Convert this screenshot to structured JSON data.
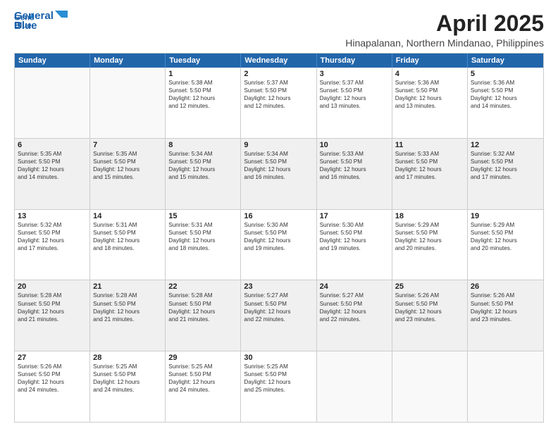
{
  "logo": {
    "line1": "General",
    "line2": "Blue"
  },
  "title": "April 2025",
  "subtitle": "Hinapalanan, Northern Mindanao, Philippines",
  "header_days": [
    "Sunday",
    "Monday",
    "Tuesday",
    "Wednesday",
    "Thursday",
    "Friday",
    "Saturday"
  ],
  "weeks": [
    [
      {
        "day": "",
        "lines": [],
        "empty": true
      },
      {
        "day": "",
        "lines": [],
        "empty": true
      },
      {
        "day": "1",
        "lines": [
          "Sunrise: 5:38 AM",
          "Sunset: 5:50 PM",
          "Daylight: 12 hours",
          "and 12 minutes."
        ]
      },
      {
        "day": "2",
        "lines": [
          "Sunrise: 5:37 AM",
          "Sunset: 5:50 PM",
          "Daylight: 12 hours",
          "and 12 minutes."
        ]
      },
      {
        "day": "3",
        "lines": [
          "Sunrise: 5:37 AM",
          "Sunset: 5:50 PM",
          "Daylight: 12 hours",
          "and 13 minutes."
        ]
      },
      {
        "day": "4",
        "lines": [
          "Sunrise: 5:36 AM",
          "Sunset: 5:50 PM",
          "Daylight: 12 hours",
          "and 13 minutes."
        ]
      },
      {
        "day": "5",
        "lines": [
          "Sunrise: 5:36 AM",
          "Sunset: 5:50 PM",
          "Daylight: 12 hours",
          "and 14 minutes."
        ]
      }
    ],
    [
      {
        "day": "6",
        "lines": [
          "Sunrise: 5:35 AM",
          "Sunset: 5:50 PM",
          "Daylight: 12 hours",
          "and 14 minutes."
        ]
      },
      {
        "day": "7",
        "lines": [
          "Sunrise: 5:35 AM",
          "Sunset: 5:50 PM",
          "Daylight: 12 hours",
          "and 15 minutes."
        ]
      },
      {
        "day": "8",
        "lines": [
          "Sunrise: 5:34 AM",
          "Sunset: 5:50 PM",
          "Daylight: 12 hours",
          "and 15 minutes."
        ]
      },
      {
        "day": "9",
        "lines": [
          "Sunrise: 5:34 AM",
          "Sunset: 5:50 PM",
          "Daylight: 12 hours",
          "and 16 minutes."
        ]
      },
      {
        "day": "10",
        "lines": [
          "Sunrise: 5:33 AM",
          "Sunset: 5:50 PM",
          "Daylight: 12 hours",
          "and 16 minutes."
        ]
      },
      {
        "day": "11",
        "lines": [
          "Sunrise: 5:33 AM",
          "Sunset: 5:50 PM",
          "Daylight: 12 hours",
          "and 17 minutes."
        ]
      },
      {
        "day": "12",
        "lines": [
          "Sunrise: 5:32 AM",
          "Sunset: 5:50 PM",
          "Daylight: 12 hours",
          "and 17 minutes."
        ]
      }
    ],
    [
      {
        "day": "13",
        "lines": [
          "Sunrise: 5:32 AM",
          "Sunset: 5:50 PM",
          "Daylight: 12 hours",
          "and 17 minutes."
        ]
      },
      {
        "day": "14",
        "lines": [
          "Sunrise: 5:31 AM",
          "Sunset: 5:50 PM",
          "Daylight: 12 hours",
          "and 18 minutes."
        ]
      },
      {
        "day": "15",
        "lines": [
          "Sunrise: 5:31 AM",
          "Sunset: 5:50 PM",
          "Daylight: 12 hours",
          "and 18 minutes."
        ]
      },
      {
        "day": "16",
        "lines": [
          "Sunrise: 5:30 AM",
          "Sunset: 5:50 PM",
          "Daylight: 12 hours",
          "and 19 minutes."
        ]
      },
      {
        "day": "17",
        "lines": [
          "Sunrise: 5:30 AM",
          "Sunset: 5:50 PM",
          "Daylight: 12 hours",
          "and 19 minutes."
        ]
      },
      {
        "day": "18",
        "lines": [
          "Sunrise: 5:29 AM",
          "Sunset: 5:50 PM",
          "Daylight: 12 hours",
          "and 20 minutes."
        ]
      },
      {
        "day": "19",
        "lines": [
          "Sunrise: 5:29 AM",
          "Sunset: 5:50 PM",
          "Daylight: 12 hours",
          "and 20 minutes."
        ]
      }
    ],
    [
      {
        "day": "20",
        "lines": [
          "Sunrise: 5:28 AM",
          "Sunset: 5:50 PM",
          "Daylight: 12 hours",
          "and 21 minutes."
        ]
      },
      {
        "day": "21",
        "lines": [
          "Sunrise: 5:28 AM",
          "Sunset: 5:50 PM",
          "Daylight: 12 hours",
          "and 21 minutes."
        ]
      },
      {
        "day": "22",
        "lines": [
          "Sunrise: 5:28 AM",
          "Sunset: 5:50 PM",
          "Daylight: 12 hours",
          "and 21 minutes."
        ]
      },
      {
        "day": "23",
        "lines": [
          "Sunrise: 5:27 AM",
          "Sunset: 5:50 PM",
          "Daylight: 12 hours",
          "and 22 minutes."
        ]
      },
      {
        "day": "24",
        "lines": [
          "Sunrise: 5:27 AM",
          "Sunset: 5:50 PM",
          "Daylight: 12 hours",
          "and 22 minutes."
        ]
      },
      {
        "day": "25",
        "lines": [
          "Sunrise: 5:26 AM",
          "Sunset: 5:50 PM",
          "Daylight: 12 hours",
          "and 23 minutes."
        ]
      },
      {
        "day": "26",
        "lines": [
          "Sunrise: 5:26 AM",
          "Sunset: 5:50 PM",
          "Daylight: 12 hours",
          "and 23 minutes."
        ]
      }
    ],
    [
      {
        "day": "27",
        "lines": [
          "Sunrise: 5:26 AM",
          "Sunset: 5:50 PM",
          "Daylight: 12 hours",
          "and 24 minutes."
        ]
      },
      {
        "day": "28",
        "lines": [
          "Sunrise: 5:25 AM",
          "Sunset: 5:50 PM",
          "Daylight: 12 hours",
          "and 24 minutes."
        ]
      },
      {
        "day": "29",
        "lines": [
          "Sunrise: 5:25 AM",
          "Sunset: 5:50 PM",
          "Daylight: 12 hours",
          "and 24 minutes."
        ]
      },
      {
        "day": "30",
        "lines": [
          "Sunrise: 5:25 AM",
          "Sunset: 5:50 PM",
          "Daylight: 12 hours",
          "and 25 minutes."
        ]
      },
      {
        "day": "",
        "lines": [],
        "empty": true
      },
      {
        "day": "",
        "lines": [],
        "empty": true
      },
      {
        "day": "",
        "lines": [],
        "empty": true
      }
    ]
  ]
}
